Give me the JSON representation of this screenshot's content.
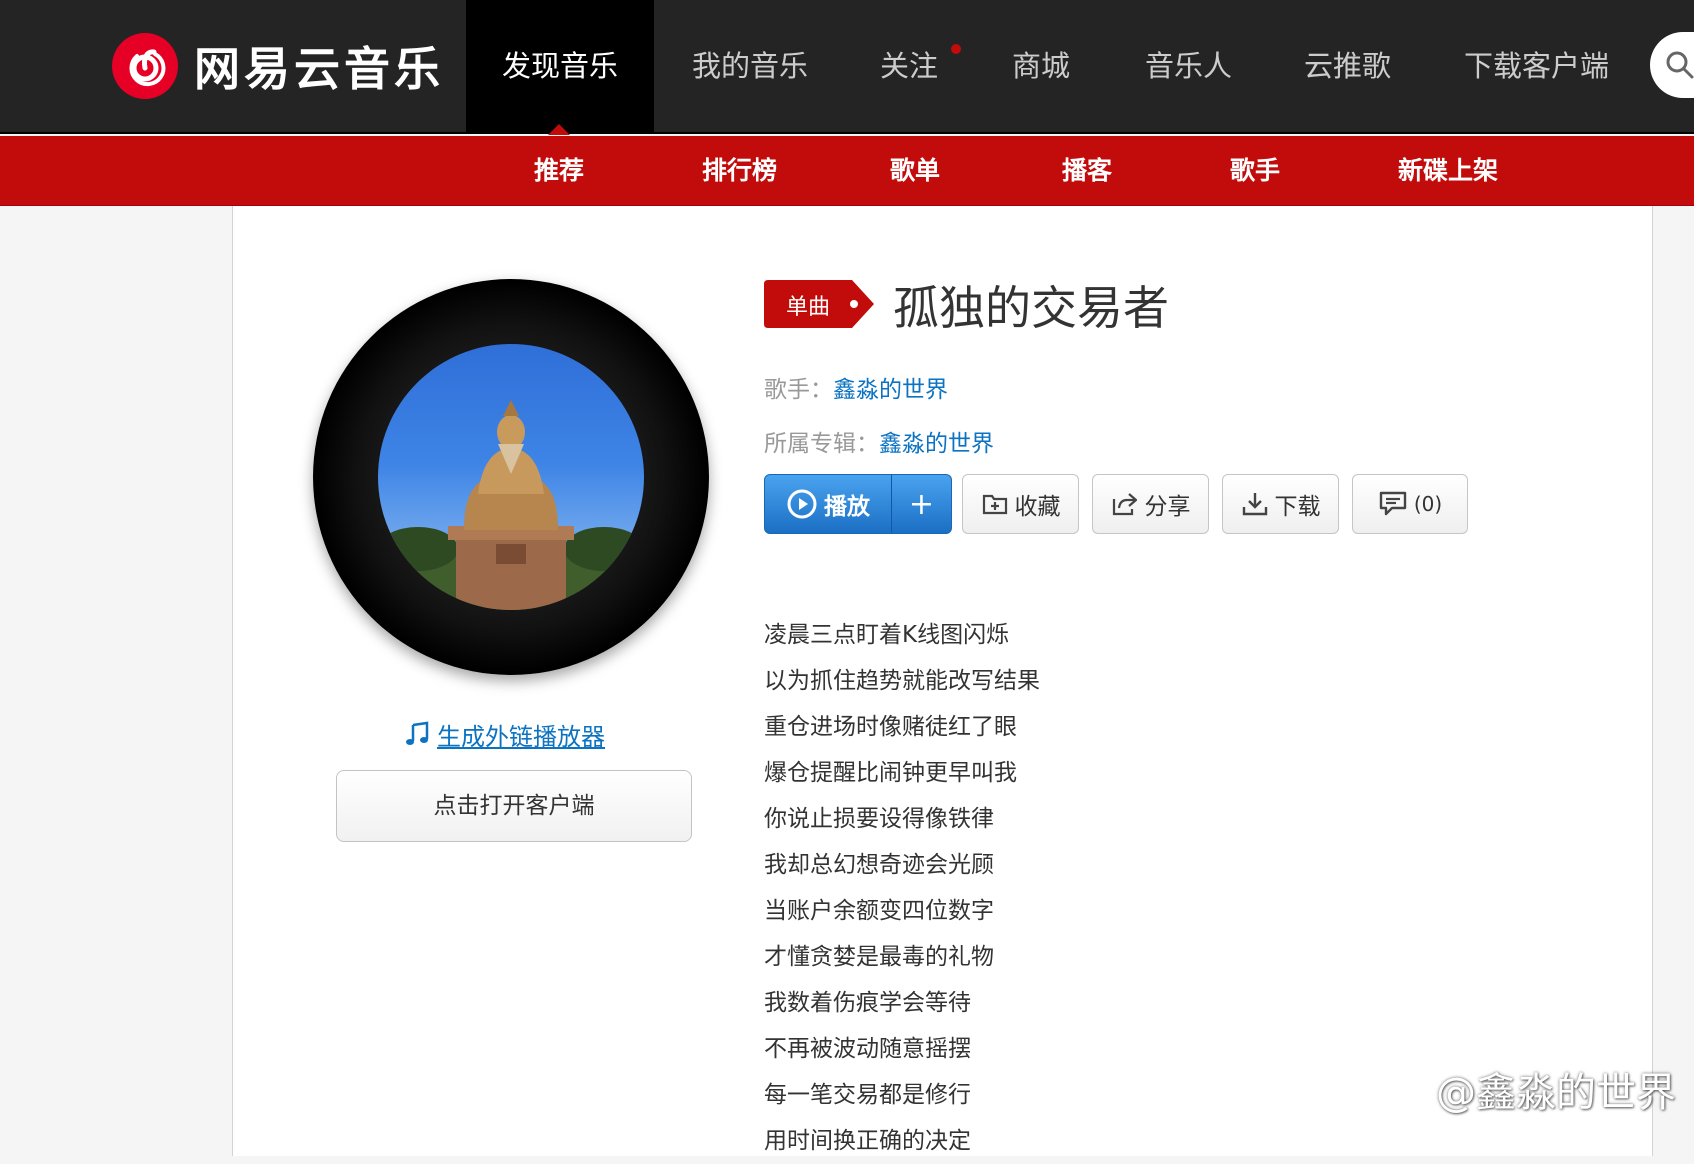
{
  "brand": {
    "name": "网易云音乐"
  },
  "topnav": {
    "items": [
      {
        "label": "发现音乐",
        "active": true
      },
      {
        "label": "我的音乐"
      },
      {
        "label": "关注",
        "dot": true
      },
      {
        "label": "商城"
      },
      {
        "label": "音乐人"
      },
      {
        "label": "云推歌"
      },
      {
        "label": "下载客户端"
      }
    ]
  },
  "subnav": {
    "items": [
      {
        "label": "推荐",
        "active": true
      },
      {
        "label": "排行榜"
      },
      {
        "label": "歌单"
      },
      {
        "label": "播客"
      },
      {
        "label": "歌手"
      },
      {
        "label": "新碟上架"
      }
    ]
  },
  "song": {
    "tag": "单曲",
    "title": "孤独的交易者",
    "artist_label": "歌手：",
    "artist": "鑫淼的世界",
    "album_label": "所属专辑：",
    "album": "鑫淼的世界"
  },
  "actions": {
    "play": "播放",
    "add": "+",
    "favorite": "收藏",
    "share": "分享",
    "download": "下载",
    "comments": "(0)"
  },
  "left": {
    "external_player_link": "生成外链播放器",
    "open_client_button": "点击打开客户端"
  },
  "lyrics": [
    "凌晨三点盯着K线图闪烁",
    "以为抓住趋势就能改写结果",
    "重仓进场时像赌徒红了眼",
    "爆仓提醒比闹钟更早叫我",
    "你说止损要设得像铁律",
    "我却总幻想奇迹会光顾",
    "当账户余额变四位数字",
    "才懂贪婪是最毒的礼物",
    "我数着伤痕学会等待",
    "不再被波动随意摇摆",
    "每一笔交易都是修行",
    "用时间换正确的决定"
  ],
  "watermark": {
    "text": "@鑫淼的世界"
  },
  "colors": {
    "topbar": "#242424",
    "accent_red": "#c20c0c",
    "link_blue": "#0c73c2"
  },
  "icons": [
    "logo-icon",
    "search-icon",
    "music-note-icon",
    "play-circle-icon",
    "add-folder-icon",
    "share-icon",
    "download-icon",
    "comment-icon",
    "zhihu-logo-icon"
  ]
}
